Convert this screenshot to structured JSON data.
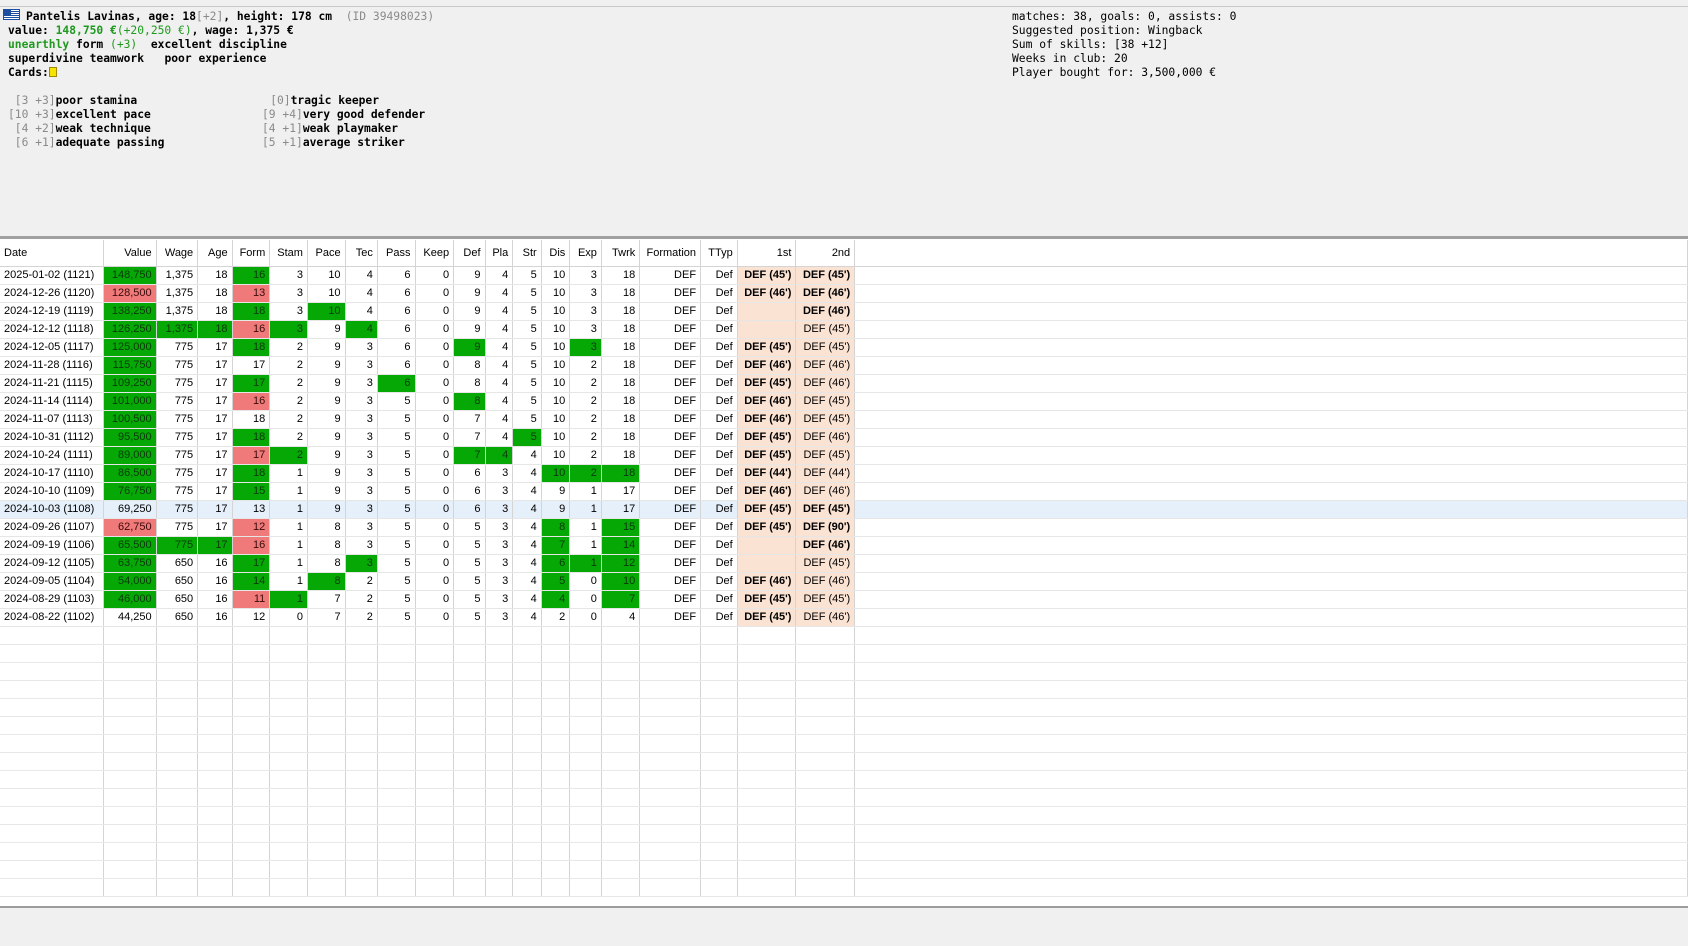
{
  "player": {
    "name_line": "Pantelis Lavinas, age: 18",
    "age_delta": "[+2]",
    "height": ", height: 178 cm",
    "id": "(ID 39498023)",
    "value_label": "value: ",
    "value": "148,750 €",
    "value_delta": "(+20,250 €)",
    "wage": ", wage: 1,375 €",
    "form_word": "unearthly",
    "form_label": " form ",
    "form_delta": "(+3)",
    "discipline": "excellent discipline",
    "teamwork": "superdivine teamwork",
    "experience": "poor experience",
    "cards_label": "Cards:"
  },
  "skills_left": [
    {
      "pre": " [3 +3]",
      "text": "poor stamina"
    },
    {
      "pre": "[10 +3]",
      "text": "excellent pace"
    },
    {
      "pre": " [4 +2]",
      "text": "weak technique"
    },
    {
      "pre": " [6 +1]",
      "text": "adequate passing"
    }
  ],
  "skills_right": [
    {
      "pre": "    [0]",
      "text": "tragic keeper"
    },
    {
      "pre": "[9 +4]",
      "text": "very good defender"
    },
    {
      "pre": "[4 +1]",
      "text": "weak playmaker"
    },
    {
      "pre": "[5 +1]",
      "text": "average striker"
    }
  ],
  "summary": [
    "matches: 38, goals: 0, assists: 0",
    "Suggested position: Wingback",
    "Sum of skills: [38 +12]",
    "Weeks in club: 20",
    "Player bought for: 3,500,000 €"
  ],
  "columns": [
    "Date",
    "Value",
    "Wage",
    "Age",
    "Form",
    "Stam",
    "Pace",
    "Tec",
    "Pass",
    "Keep",
    "Def",
    "Pla",
    "Str",
    "Dis",
    "Exp",
    "Twrk",
    "Formation",
    "TTyp",
    "1st",
    "2nd"
  ],
  "rows": [
    {
      "c": [
        "2025-01-02 (1121)",
        "148,750",
        "1,375",
        "18",
        "16",
        "3",
        "10",
        "4",
        "6",
        "0",
        "9",
        "4",
        "5",
        "10",
        "3",
        "18",
        "DEF",
        "Def",
        "DEF (45')",
        "DEF (45')"
      ],
      "h": {
        "1": "g",
        "4": "g"
      },
      "b": "BB"
    },
    {
      "c": [
        "2024-12-26 (1120)",
        "128,500",
        "1,375",
        "18",
        "13",
        "3",
        "10",
        "4",
        "6",
        "0",
        "9",
        "4",
        "5",
        "10",
        "3",
        "18",
        "DEF",
        "Def",
        "DEF (46')",
        "DEF (46')"
      ],
      "h": {
        "1": "r",
        "4": "r"
      },
      "b": "BB"
    },
    {
      "c": [
        "2024-12-19 (1119)",
        "138,250",
        "1,375",
        "18",
        "18",
        "3",
        "10",
        "4",
        "6",
        "0",
        "9",
        "4",
        "5",
        "10",
        "3",
        "18",
        "DEF",
        "Def",
        "",
        "DEF (46')"
      ],
      "h": {
        "1": "g",
        "4": "g",
        "6": "g"
      },
      "b": "-B"
    },
    {
      "c": [
        "2024-12-12 (1118)",
        "126,250",
        "1,375",
        "18",
        "16",
        "3",
        "9",
        "4",
        "6",
        "0",
        "9",
        "4",
        "5",
        "10",
        "3",
        "18",
        "DEF",
        "Def",
        "",
        "DEF (45')"
      ],
      "h": {
        "1": "g",
        "2": "g",
        "3": "g",
        "4": "r",
        "5": "g",
        "7": "g"
      },
      "b": "-N"
    },
    {
      "c": [
        "2024-12-05 (1117)",
        "125,000",
        "775",
        "17",
        "18",
        "2",
        "9",
        "3",
        "6",
        "0",
        "9",
        "4",
        "5",
        "10",
        "3",
        "18",
        "DEF",
        "Def",
        "DEF (45')",
        "DEF (45')"
      ],
      "h": {
        "1": "g",
        "4": "g",
        "10": "g",
        "14": "g"
      },
      "b": "BN"
    },
    {
      "c": [
        "2024-11-28 (1116)",
        "115,750",
        "775",
        "17",
        "17",
        "2",
        "9",
        "3",
        "6",
        "0",
        "8",
        "4",
        "5",
        "10",
        "2",
        "18",
        "DEF",
        "Def",
        "DEF (46')",
        "DEF (46')"
      ],
      "h": {
        "1": "g"
      },
      "b": "BN"
    },
    {
      "c": [
        "2024-11-21 (1115)",
        "109,250",
        "775",
        "17",
        "17",
        "2",
        "9",
        "3",
        "6",
        "0",
        "8",
        "4",
        "5",
        "10",
        "2",
        "18",
        "DEF",
        "Def",
        "DEF (45')",
        "DEF (46')"
      ],
      "h": {
        "1": "g",
        "4": "g",
        "8": "g"
      },
      "b": "BN"
    },
    {
      "c": [
        "2024-11-14 (1114)",
        "101,000",
        "775",
        "17",
        "16",
        "2",
        "9",
        "3",
        "5",
        "0",
        "8",
        "4",
        "5",
        "10",
        "2",
        "18",
        "DEF",
        "Def",
        "DEF (46')",
        "DEF (45')"
      ],
      "h": {
        "1": "g",
        "4": "r",
        "10": "g"
      },
      "b": "BN"
    },
    {
      "c": [
        "2024-11-07 (1113)",
        "100,500",
        "775",
        "17",
        "18",
        "2",
        "9",
        "3",
        "5",
        "0",
        "7",
        "4",
        "5",
        "10",
        "2",
        "18",
        "DEF",
        "Def",
        "DEF (46')",
        "DEF (45')"
      ],
      "h": {
        "1": "g"
      },
      "b": "BN"
    },
    {
      "c": [
        "2024-10-31 (1112)",
        "95,500",
        "775",
        "17",
        "18",
        "2",
        "9",
        "3",
        "5",
        "0",
        "7",
        "4",
        "5",
        "10",
        "2",
        "18",
        "DEF",
        "Def",
        "DEF (45')",
        "DEF (46')"
      ],
      "h": {
        "1": "g",
        "4": "g",
        "12": "g"
      },
      "b": "BN"
    },
    {
      "c": [
        "2024-10-24 (1111)",
        "89,000",
        "775",
        "17",
        "17",
        "2",
        "9",
        "3",
        "5",
        "0",
        "7",
        "4",
        "4",
        "10",
        "2",
        "18",
        "DEF",
        "Def",
        "DEF (45')",
        "DEF (45')"
      ],
      "h": {
        "1": "g",
        "4": "r",
        "5": "g",
        "10": "g",
        "11": "g"
      },
      "b": "BN"
    },
    {
      "c": [
        "2024-10-17 (1110)",
        "86,500",
        "775",
        "17",
        "18",
        "1",
        "9",
        "3",
        "5",
        "0",
        "6",
        "3",
        "4",
        "10",
        "2",
        "18",
        "DEF",
        "Def",
        "DEF (44')",
        "DEF (44')"
      ],
      "h": {
        "1": "g",
        "4": "g",
        "13": "g",
        "14": "g",
        "15": "g"
      },
      "b": "BN"
    },
    {
      "c": [
        "2024-10-10 (1109)",
        "76,750",
        "775",
        "17",
        "15",
        "1",
        "9",
        "3",
        "5",
        "0",
        "6",
        "3",
        "4",
        "9",
        "1",
        "17",
        "DEF",
        "Def",
        "DEF (46')",
        "DEF (46')"
      ],
      "h": {
        "1": "g",
        "4": "g"
      },
      "b": "BN"
    },
    {
      "c": [
        "2024-10-03 (1108)",
        "69,250",
        "775",
        "17",
        "13",
        "1",
        "9",
        "3",
        "5",
        "0",
        "6",
        "3",
        "4",
        "9",
        "1",
        "17",
        "DEF",
        "Def",
        "DEF (45')",
        "DEF (45')"
      ],
      "h": {},
      "b": "BB",
      "sel": true
    },
    {
      "c": [
        "2024-09-26 (1107)",
        "62,750",
        "775",
        "17",
        "12",
        "1",
        "8",
        "3",
        "5",
        "0",
        "5",
        "3",
        "4",
        "8",
        "1",
        "15",
        "DEF",
        "Def",
        "DEF (45')",
        "DEF (90')"
      ],
      "h": {
        "1": "r",
        "4": "r",
        "13": "g",
        "15": "g"
      },
      "b": "BB"
    },
    {
      "c": [
        "2024-09-19 (1106)",
        "65,500",
        "775",
        "17",
        "16",
        "1",
        "8",
        "3",
        "5",
        "0",
        "5",
        "3",
        "4",
        "7",
        "1",
        "14",
        "DEF",
        "Def",
        "",
        "DEF (46')"
      ],
      "h": {
        "1": "g",
        "2": "g",
        "3": "g",
        "4": "r",
        "13": "g",
        "15": "g"
      },
      "b": "-B"
    },
    {
      "c": [
        "2024-09-12 (1105)",
        "63,750",
        "650",
        "16",
        "17",
        "1",
        "8",
        "3",
        "5",
        "0",
        "5",
        "3",
        "4",
        "6",
        "1",
        "12",
        "DEF",
        "Def",
        "",
        "DEF (45')"
      ],
      "h": {
        "1": "g",
        "4": "g",
        "7": "g",
        "13": "g",
        "14": "g",
        "15": "g"
      },
      "b": "-N"
    },
    {
      "c": [
        "2024-09-05 (1104)",
        "54,000",
        "650",
        "16",
        "14",
        "1",
        "8",
        "2",
        "5",
        "0",
        "5",
        "3",
        "4",
        "5",
        "0",
        "10",
        "DEF",
        "Def",
        "DEF (46')",
        "DEF (46')"
      ],
      "h": {
        "1": "g",
        "4": "g",
        "6": "g",
        "13": "g",
        "15": "g"
      },
      "b": "BN"
    },
    {
      "c": [
        "2024-08-29 (1103)",
        "46,000",
        "650",
        "16",
        "11",
        "1",
        "7",
        "2",
        "5",
        "0",
        "5",
        "3",
        "4",
        "4",
        "0",
        "7",
        "DEF",
        "Def",
        "DEF (45')",
        "DEF (45')"
      ],
      "h": {
        "1": "g",
        "4": "r",
        "5": "g",
        "13": "g",
        "15": "g"
      },
      "b": "BN"
    },
    {
      "c": [
        "2024-08-22 (1102)",
        "44,250",
        "650",
        "16",
        "12",
        "0",
        "7",
        "2",
        "5",
        "0",
        "5",
        "3",
        "4",
        "2",
        "0",
        "4",
        "DEF",
        "Def",
        "DEF (45')",
        "DEF (46')"
      ],
      "h": {},
      "b": "BN"
    }
  ],
  "colors": {
    "green": "#06a806",
    "red": "#f07a7a",
    "peach": "#fbe3d4",
    "selected": "#e6f0fa"
  }
}
